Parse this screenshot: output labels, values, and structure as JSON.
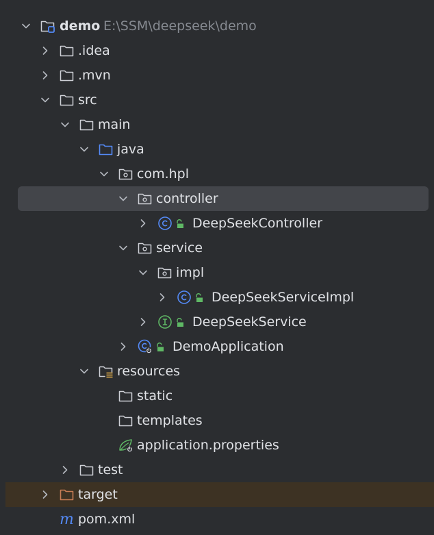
{
  "project": {
    "name": "demo",
    "path": "E:\\SSM\\deepseek\\demo"
  },
  "tree": {
    "idea": ".idea",
    "mvn": ".mvn",
    "src": "src",
    "main": "main",
    "java": "java",
    "package": "com.hpl",
    "controller": "controller",
    "deepseek_controller": "DeepSeekController",
    "service": "service",
    "impl": "impl",
    "deepseek_service_impl": "DeepSeekServiceImpl",
    "deepseek_service": "DeepSeekService",
    "demo_application": "DemoApplication",
    "resources": "resources",
    "static": "static",
    "templates": "templates",
    "application_properties": "application.properties",
    "test": "test",
    "target": "target",
    "pom": "pom.xml"
  },
  "colors": {
    "background": "#2b2d30",
    "selected_row": "#43454a",
    "excluded_row": "#3d3223",
    "text": "#dfe1e5",
    "path_text": "#868a91",
    "source_folder": "#548af7",
    "class_icon": "#548af7",
    "interface_icon": "#5fb865",
    "lock_badge": "#5fb865",
    "excluded_folder": "#c77d55",
    "maven_icon": "#548af7"
  },
  "icons": {
    "project": "module-folder-icon",
    "folder": "folder-icon",
    "source_folder": "source-root-folder-icon",
    "package": "package-icon",
    "class": "class-icon",
    "interface": "interface-icon",
    "spring_app": "spring-boot-application-icon",
    "resources": "resources-root-icon",
    "properties": "spring-properties-icon",
    "excluded": "excluded-folder-icon",
    "maven": "maven-icon",
    "expanded": "chevron-down-icon",
    "collapsed": "chevron-right-icon"
  }
}
